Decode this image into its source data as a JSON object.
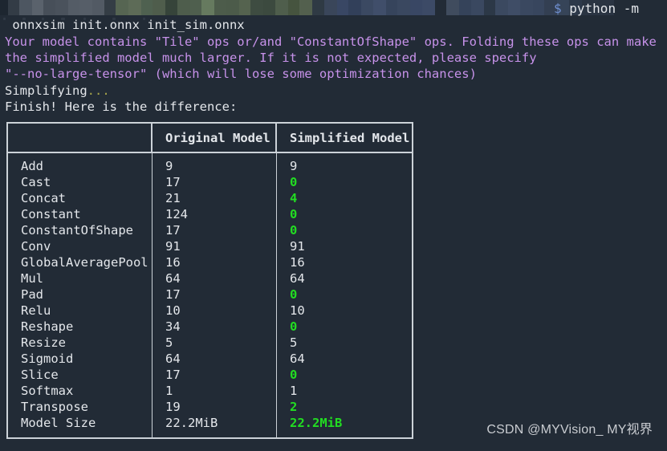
{
  "terminal": {
    "background_color": "#222b36",
    "foreground_color": "#e4e7eb",
    "censored_prompt_note": "pixelated/redacted shell prompt",
    "prompt_tail": "$ python -m",
    "prompt_dollar": "$",
    "prompt_command": " python -m",
    "command_line": " onnxsim init.onnx init_sim.onnx",
    "warning_color": "#c792ea",
    "warning_lines": [
      "Your model contains \"Tile\" ops or/and \"ConstantOfShape\" ops. Folding these ops can make",
      "the simplified model much larger. If it is not expected, please specify",
      "\"--no-large-tensor\" (which will lose some optimization chances)"
    ],
    "simplifying_label": "Simplifying",
    "simplifying_dots": "...",
    "simplifying_dots_color": "#a6a44a",
    "finish_line": "Finish! Here is the difference:"
  },
  "table": {
    "border_color": "#ccd2d8",
    "changed_color": "#22dd22",
    "headers": [
      "",
      "Original Model",
      "Simplified Model"
    ],
    "rows": [
      {
        "op": "Add",
        "original": "9",
        "simplified": "9",
        "changed": false
      },
      {
        "op": "Cast",
        "original": "17",
        "simplified": "0",
        "changed": true
      },
      {
        "op": "Concat",
        "original": "21",
        "simplified": "4",
        "changed": true
      },
      {
        "op": "Constant",
        "original": "124",
        "simplified": "0",
        "changed": true
      },
      {
        "op": "ConstantOfShape",
        "original": "17",
        "simplified": "0",
        "changed": true
      },
      {
        "op": "Conv",
        "original": "91",
        "simplified": "91",
        "changed": false
      },
      {
        "op": "GlobalAveragePool",
        "original": "16",
        "simplified": "16",
        "changed": false
      },
      {
        "op": "Mul",
        "original": "64",
        "simplified": "64",
        "changed": false
      },
      {
        "op": "Pad",
        "original": "17",
        "simplified": "0",
        "changed": true
      },
      {
        "op": "Relu",
        "original": "10",
        "simplified": "10",
        "changed": false
      },
      {
        "op": "Reshape",
        "original": "34",
        "simplified": "0",
        "changed": true
      },
      {
        "op": "Resize",
        "original": "5",
        "simplified": "5",
        "changed": false
      },
      {
        "op": "Sigmoid",
        "original": "64",
        "simplified": "64",
        "changed": false
      },
      {
        "op": "Slice",
        "original": "17",
        "simplified": "0",
        "changed": true
      },
      {
        "op": "Softmax",
        "original": "1",
        "simplified": "1",
        "changed": false
      },
      {
        "op": "Transpose",
        "original": "19",
        "simplified": "2",
        "changed": true
      },
      {
        "op": "Model Size",
        "original": "22.2MiB",
        "simplified": "22.2MiB",
        "changed": true
      }
    ]
  },
  "watermark": {
    "text": "CSDN @MYVision_ MY视界"
  },
  "mosaic": {
    "blocks": [
      {
        "w": 10,
        "c": "#1d2630"
      },
      {
        "w": 14,
        "c": "#333c46"
      },
      {
        "w": 16,
        "c": "#4d5661"
      },
      {
        "w": 14,
        "c": "#5a626c"
      },
      {
        "w": 15,
        "c": "#474f59"
      },
      {
        "w": 16,
        "c": "#4a525c"
      },
      {
        "w": 14,
        "c": "#545c66"
      },
      {
        "w": 16,
        "c": "#565e68"
      },
      {
        "w": 15,
        "c": "#525a64"
      },
      {
        "w": 14,
        "c": "#343d45"
      },
      {
        "w": 16,
        "c": "#566552"
      },
      {
        "w": 16,
        "c": "#5d6b57"
      },
      {
        "w": 14,
        "c": "#4f6150"
      },
      {
        "w": 16,
        "c": "#4f5d4c"
      },
      {
        "w": 15,
        "c": "#36443a"
      },
      {
        "w": 16,
        "c": "#4e5d4c"
      },
      {
        "w": 14,
        "c": "#4f5f4e"
      },
      {
        "w": 16,
        "c": "#667a5f"
      },
      {
        "w": 15,
        "c": "#4d5c4b"
      },
      {
        "w": 16,
        "c": "#4c5b4a"
      },
      {
        "w": 14,
        "c": "#55634f"
      },
      {
        "w": 16,
        "c": "#3e4c41"
      },
      {
        "w": 15,
        "c": "#3c4a3f"
      },
      {
        "w": 16,
        "c": "#4f5e4c"
      },
      {
        "w": 14,
        "c": "#46543f"
      },
      {
        "w": 16,
        "c": "#53604e"
      },
      {
        "w": 15,
        "c": "#2f3a44"
      },
      {
        "w": 16,
        "c": "#3a465a"
      },
      {
        "w": 14,
        "c": "#394764"
      },
      {
        "w": 16,
        "c": "#32405a"
      },
      {
        "w": 15,
        "c": "#3b4962"
      },
      {
        "w": 16,
        "c": "#404e6a"
      },
      {
        "w": 14,
        "c": "#36445c"
      },
      {
        "w": 16,
        "c": "#3a4860"
      },
      {
        "w": 15,
        "c": "#394764"
      },
      {
        "w": 16,
        "c": "#3c4a66"
      },
      {
        "w": 14,
        "c": "#222b36"
      },
      {
        "w": 16,
        "c": "#404c5e"
      },
      {
        "w": 15,
        "c": "#35435a"
      },
      {
        "w": 16,
        "c": "#3a4860"
      },
      {
        "w": 14,
        "c": "#2c3847"
      },
      {
        "w": 16,
        "c": "#3b4960"
      },
      {
        "w": 15,
        "c": "#3f4d66"
      },
      {
        "w": 16,
        "c": "#3a4860"
      },
      {
        "w": 14,
        "c": "#38465e"
      },
      {
        "w": 16,
        "c": "#333f52"
      },
      {
        "w": 15,
        "c": "#364458"
      },
      {
        "w": 16,
        "c": "#2d394a"
      },
      {
        "w": 40,
        "c": "#2a3442"
      }
    ]
  }
}
